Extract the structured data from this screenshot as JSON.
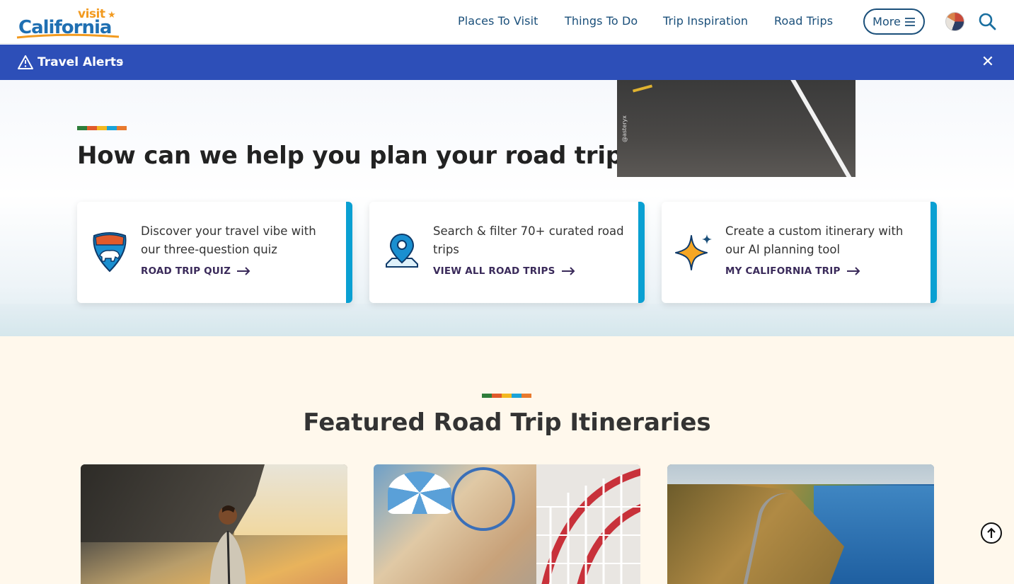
{
  "header": {
    "logo_top": "visit",
    "logo_main": "California",
    "nav": [
      "Places To Visit",
      "Things To Do",
      "Trip Inspiration",
      "Road Trips"
    ],
    "more_label": "More"
  },
  "alerts": {
    "label": "Travel Alerts"
  },
  "plan": {
    "title": "How can we help you plan your road trip?",
    "image_credit": "@asteryx",
    "cards": [
      {
        "text": "Discover your travel vibe with our three-question quiz",
        "cta": "ROAD TRIP QUIZ",
        "icon": "bear-shield-icon"
      },
      {
        "text": "Search & filter 70+ curated road trips",
        "cta": "VIEW ALL ROAD TRIPS",
        "icon": "map-pin-icon"
      },
      {
        "text": "Create a custom itinerary with our AI planning tool",
        "cta": "MY CALIFORNIA TRIP",
        "icon": "sparkle-icon"
      }
    ]
  },
  "featured": {
    "title": "Featured Road Trip Itineraries"
  },
  "colors": {
    "brand_blue": "#1f6fb2",
    "nav_text": "#1a4f7a",
    "alert_bar": "#2d4fb8",
    "card_accent": "#0aa0d2",
    "cta_text": "#3a2a5a",
    "featured_bg": "#fff8ec",
    "stripe": [
      "#2e7d3a",
      "#e05a2b",
      "#f3b81f",
      "#1aa3d8",
      "#e8792d"
    ]
  }
}
